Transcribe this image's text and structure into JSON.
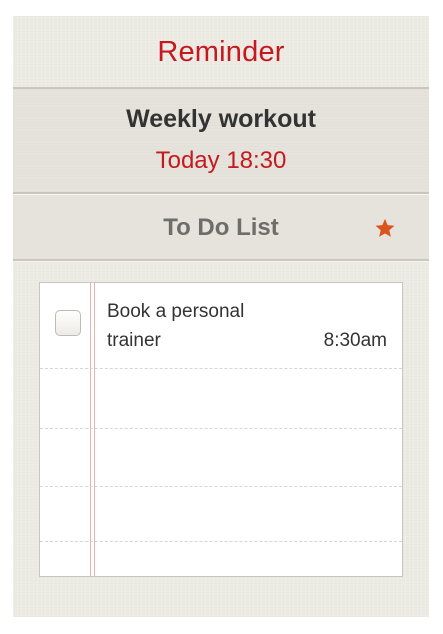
{
  "header": {
    "title": "Reminder"
  },
  "reminder": {
    "title": "Weekly workout",
    "time": "Today 18:30"
  },
  "todo": {
    "title": "To Do List",
    "star_icon": "star-icon",
    "items": [
      {
        "text": "Book a personal trainer",
        "time": "8:30am",
        "checked": false
      }
    ]
  },
  "colors": {
    "accent_red": "#c41a1f",
    "star_orange": "#d9541e",
    "background": "#eceae3"
  }
}
